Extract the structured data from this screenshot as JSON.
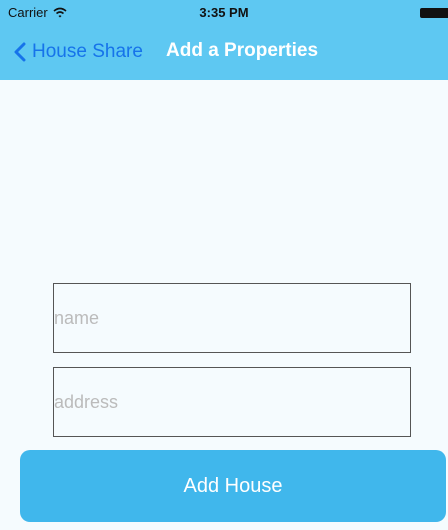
{
  "status_bar": {
    "carrier": "Carrier",
    "time": "3:35 PM"
  },
  "nav": {
    "back_label": "House Share",
    "title": "Add a Properties"
  },
  "form": {
    "name_placeholder": "name",
    "name_value": "",
    "address_placeholder": "address",
    "address_value": "",
    "submit_label": "Add House"
  },
  "colors": {
    "nav_background": "#5ec8f2",
    "back_link": "#1673ea",
    "button_background": "#40b7ec",
    "page_background": "#f5fbfe"
  },
  "icons": {
    "status": [
      "wifi-icon",
      "battery-icon"
    ],
    "nav": [
      "chevron-left-icon"
    ]
  }
}
